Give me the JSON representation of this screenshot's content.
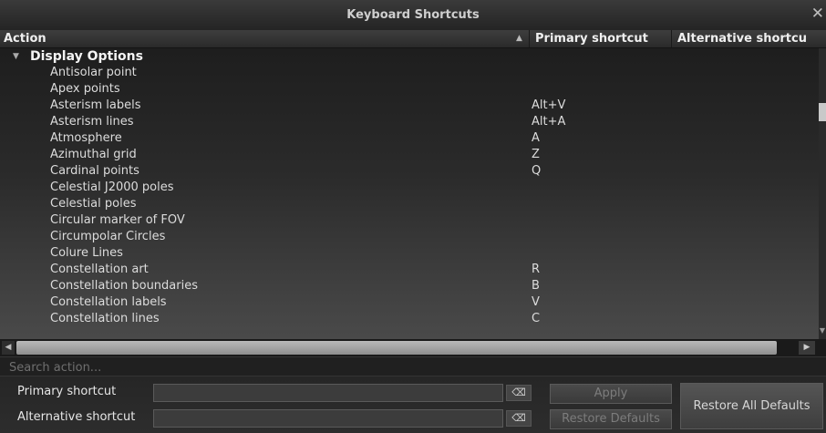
{
  "window": {
    "title": "Keyboard Shortcuts",
    "close_symbol": "✕"
  },
  "table": {
    "headers": {
      "action": "Action",
      "primary": "Primary shortcut",
      "alternative": "Alternative shortcu"
    },
    "group": "Display Options",
    "rows": [
      {
        "action": "Antisolar point",
        "primary": "",
        "alt": ""
      },
      {
        "action": "Apex points",
        "primary": "",
        "alt": ""
      },
      {
        "action": "Asterism labels",
        "primary": "Alt+V",
        "alt": ""
      },
      {
        "action": "Asterism lines",
        "primary": "Alt+A",
        "alt": ""
      },
      {
        "action": "Atmosphere",
        "primary": "A",
        "alt": ""
      },
      {
        "action": "Azimuthal grid",
        "primary": "Z",
        "alt": ""
      },
      {
        "action": "Cardinal points",
        "primary": "Q",
        "alt": ""
      },
      {
        "action": "Celestial J2000 poles",
        "primary": "",
        "alt": ""
      },
      {
        "action": "Celestial poles",
        "primary": "",
        "alt": ""
      },
      {
        "action": "Circular marker of FOV",
        "primary": "",
        "alt": ""
      },
      {
        "action": "Circumpolar Circles",
        "primary": "",
        "alt": ""
      },
      {
        "action": "Colure Lines",
        "primary": "",
        "alt": ""
      },
      {
        "action": "Constellation art",
        "primary": "R",
        "alt": ""
      },
      {
        "action": "Constellation boundaries",
        "primary": "B",
        "alt": ""
      },
      {
        "action": "Constellation labels",
        "primary": "V",
        "alt": ""
      },
      {
        "action": "Constellation lines",
        "primary": "C",
        "alt": ""
      }
    ]
  },
  "search": {
    "placeholder": "Search action..."
  },
  "editor": {
    "primary_label": "Primary shortcut",
    "alternative_label": "Alternative shortcut",
    "clear_symbol": "⌫",
    "apply_label": "Apply",
    "restore_defaults_label": "Restore Defaults",
    "restore_all_label": "Restore All Defaults"
  }
}
